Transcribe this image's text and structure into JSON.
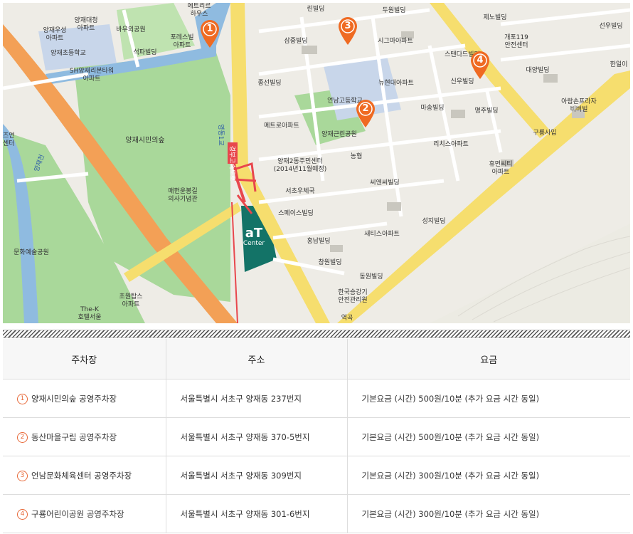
{
  "colors": {
    "pin": "#ef6a22",
    "circle": "#e86a3a",
    "road_orange": "#f3a056",
    "road_yellow": "#f6de6e",
    "park": "#a9d89a",
    "water": "#8fbbe0",
    "at_center": "#137367"
  },
  "map": {
    "labels": {
      "yangjae_daecheong_apt": "양재대청\n아파트",
      "yangjae_usung_apt": "양재우성\n아파트",
      "yangjae_elem": "양재초등학교",
      "sh_apt": "SH양재리본타워\n아파트",
      "baeuoe_park": "바우외공원",
      "forest_apt": "포레스빌\n아파트",
      "seokpa_bldg": "석파빌딩",
      "hanawo": "에트리르\n하우스",
      "rinbil": "린빌딩",
      "duwon": "두원빌딩",
      "jenobil": "제노빌딩",
      "seonwoo": "선우빌딩",
      "samjung": "삼중빌딩",
      "sigma_apt": "시그마아파트",
      "gaepo119": "개포119\n안전센터",
      "standard": "스탠다드빌딩",
      "daeyang": "대양빌딩",
      "hanil": "한일이",
      "jongseon": "종선빌딩",
      "newhanil_apt": "뉴현대아파트",
      "sinwoo": "신우빌딩",
      "arirang": "아람손프라자\n비버빌",
      "eonnam_high": "언남고등학교",
      "masung": "마송빌딩",
      "myeongju": "명주빌딩",
      "metro_apt": "메트로아파트",
      "yangjae_park": "양재근린공원",
      "yangjaesimin": "양재시민의숲",
      "richis": "리치스아파트",
      "guryongsa": "구룡사입",
      "nonghyup": "농협",
      "yangjae2_center": "양재2동주민센터\n(2014년11월예정)",
      "huemen_apt": "휴먼씨티\n아파트",
      "seocho_post": "서초우체국",
      "ssien": "씨엔씨빌딩",
      "memorial": "매헌윤봉길\n의사기념관",
      "space": "스페이스빌딩",
      "saetis_apt": "새티스아파트",
      "seongji": "성지빌딩",
      "hongnam": "홍남빌딩",
      "culture_park": "문화예술공원",
      "changwon": "창원빌딩",
      "dongwon": "동원빌딩",
      "hankook": "한국승강기\n안전관리원",
      "chowon_apt": "초원탑스\n아파트",
      "thek": "The-K\n호텔서울",
      "yeokgu": "역곡",
      "center_left": "즈연\n센터",
      "road_yangjae": "양재천",
      "road_gyeongbu": "경부고속도로",
      "road_yeongdong": "영동1교"
    },
    "pins": [
      "1",
      "2",
      "3",
      "4"
    ],
    "at_center": {
      "line1": "aT",
      "line2": "Center"
    }
  },
  "table": {
    "headers": [
      "주차장",
      "주소",
      "요금"
    ],
    "rows": [
      {
        "num": "1",
        "name": "양재시민의숲 공영주차장",
        "address": "서울특별시 서초구 양재동 237번지",
        "fee": "기본요금 (시간) 500원/10분 (추가 요금 시간 동일)"
      },
      {
        "num": "2",
        "name": "동산마을구립 공영주차장",
        "address": "서울특별시 서초구 양재동 370-5번지",
        "fee": "기본요금 (시간) 500원/10분 (추가 요금 시간 동일)"
      },
      {
        "num": "3",
        "name": "언남문화체육센터 공영주차장",
        "address": "서울특별시 서초구 양재동 309번지",
        "fee": "기본요금 (시간) 300원/10분 (추가 요금 시간 동일)"
      },
      {
        "num": "4",
        "name": "구룡어린이공원 공영주차장",
        "address": "서울특별시 서초구 양재동 301-6번지",
        "fee": "기본요금 (시간) 300원/10분 (추가 요금 시간 동일)"
      }
    ]
  }
}
